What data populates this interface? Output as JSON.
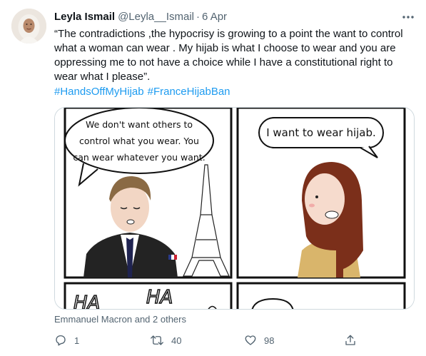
{
  "author": {
    "name": "Leyla Ismail",
    "handle": "@Leyla__Ismail",
    "separator": "·",
    "date": "6 Apr"
  },
  "tweet": {
    "text": "“The contradictions ,the hypocrisy is growing to a point the want to control what a woman can wear . My hijab is what I choose to wear and you are oppressing me to not have a choice while I have a constitutional right to wear what I please”.",
    "hashtags": [
      "#HandsOffMyHijab",
      "#FranceHijabBan"
    ]
  },
  "comic": {
    "panel1_bubble_lines": [
      "We don't want others to",
      "control what you wear. You",
      "can wear whatever you want."
    ],
    "panel2_bubble": "I want to wear hijab.",
    "panel3_sfx1": "HA",
    "panel3_sfx2": "HA"
  },
  "tagged": "Emmanuel Macron and 2 others",
  "actions": {
    "reply_count": "1",
    "retweet_count": "40",
    "like_count": "98"
  },
  "icons": {
    "more": "more-horizontal-icon",
    "reply": "reply-icon",
    "retweet": "retweet-icon",
    "like": "heart-icon",
    "share": "share-icon"
  },
  "colors": {
    "link": "#1d9bf0",
    "secondary_text": "#536471",
    "primary_text": "#0f1419",
    "hijab": "#7b2f1a",
    "shirt": "#d9b56b"
  }
}
